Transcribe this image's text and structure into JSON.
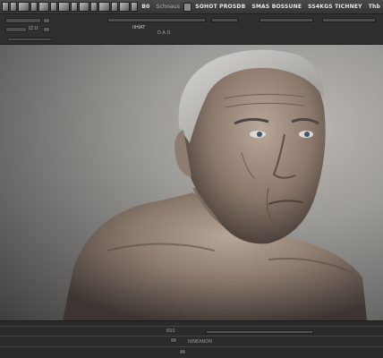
{
  "topbar": {
    "label_1": "B0",
    "label_2": "Schnaus",
    "label_3": "SOHOT PROSDB",
    "label_4": "SMAS BOSSUNE",
    "label_5": "SS4KGS TICHNEY",
    "label_6": "Thb"
  },
  "toolbar": {
    "field_value": "IZ.U",
    "center_label_1": "IIHIAT",
    "center_label_2": "D A O"
  },
  "bottom": {
    "label_1": "6SS",
    "label_2": "NINEANON"
  },
  "colors": {
    "chrome_dark": "#2f2f2f",
    "chrome_mid": "#3a3a3a",
    "canvas_bg": "#9c9a96"
  },
  "canvas": {
    "content": "photo-portrait-elderly-man"
  }
}
